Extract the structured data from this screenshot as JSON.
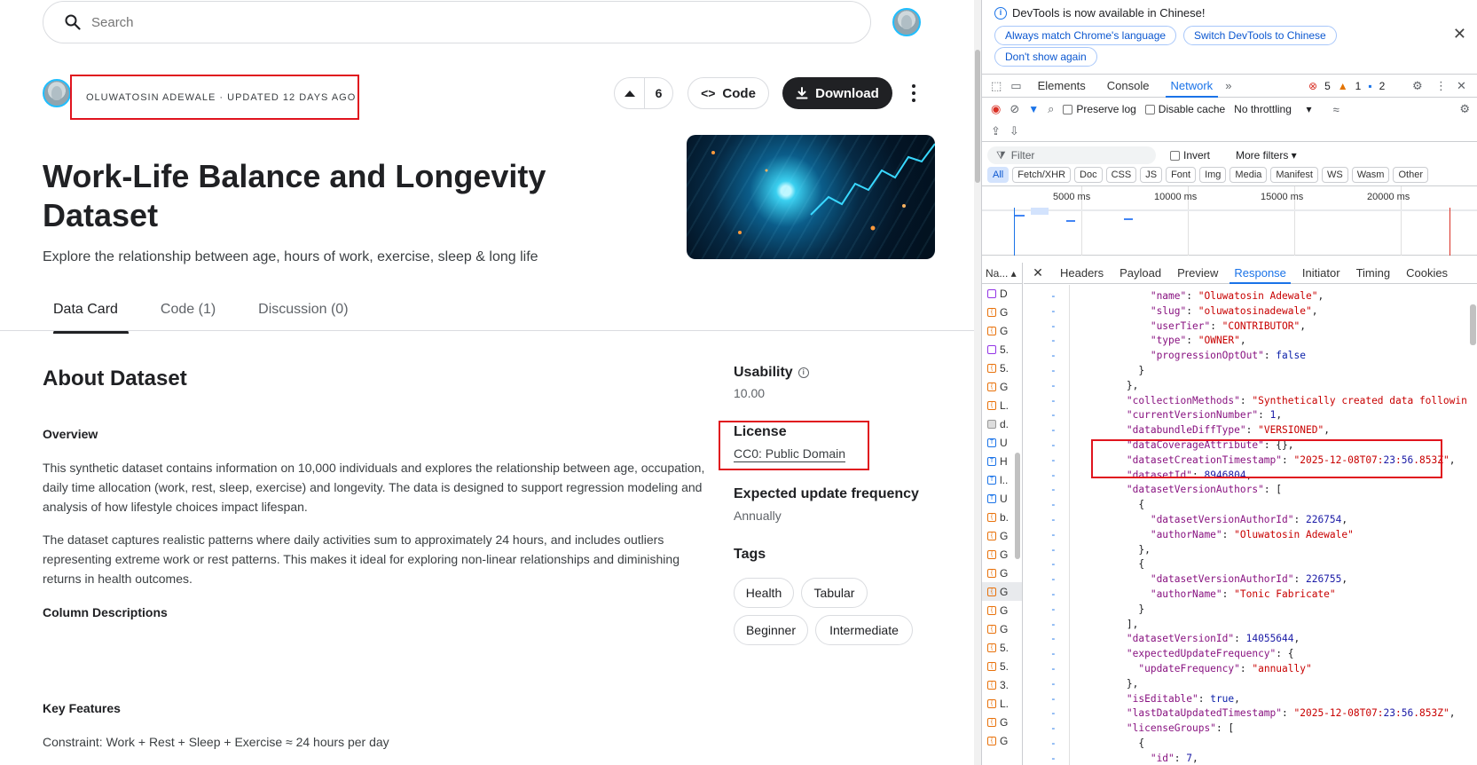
{
  "page": {
    "search_placeholder": "Search",
    "owner_line": "OLUWATOSIN ADEWALE · UPDATED 12 DAYS AGO",
    "vote_count": "6",
    "code_label": "Code",
    "download_label": "Download",
    "title": "Work-Life Balance and Longevity Dataset",
    "subtitle": "Explore the relationship between age, hours of work, exercise, sleep & long life",
    "tabs": [
      "Data Card",
      "Code (1)",
      "Discussion (0)"
    ],
    "about_heading": "About Dataset",
    "overview_heading": "Overview",
    "para1": "This synthetic dataset contains information on 10,000 individuals and explores the relationship between age, occupation, daily time allocation (work, rest, sleep, exercise) and longevity. The data is designed to support regression modeling and analysis of how lifestyle choices impact lifespan.",
    "para2": "The dataset captures realistic patterns where daily activities sum to approximately 24 hours, and includes outliers representing extreme work or rest patterns. This makes it ideal for exploring non-linear relationships and diminishing returns in health outcomes.",
    "column_heading": "Column Descriptions",
    "key_heading": "Key Features",
    "key_line": "Constraint: Work + Rest + Sleep + Exercise ≈ 24 hours per day",
    "usability_label": "Usability",
    "usability_value": "10.00",
    "license_label": "License",
    "license_value": "CC0: Public Domain",
    "freq_label": "Expected update frequency",
    "freq_value": "Annually",
    "tags_label": "Tags",
    "tags": [
      "Health",
      "Tabular",
      "Beginner",
      "Intermediate"
    ]
  },
  "devtools": {
    "info_message": "DevTools is now available in Chinese!",
    "btn_match": "Always match Chrome's language",
    "btn_switch": "Switch DevTools to Chinese",
    "btn_dont": "Don't show again",
    "tabs": [
      "Elements",
      "Console",
      "Network"
    ],
    "errors": "5",
    "warnings": "1",
    "messages": "2",
    "preserve_log": "Preserve log",
    "disable_cache": "Disable cache",
    "throttling": "No throttling",
    "filter_placeholder": "Filter",
    "invert": "Invert",
    "more_filters": "More filters",
    "types": [
      "All",
      "Fetch/XHR",
      "Doc",
      "CSS",
      "JS",
      "Font",
      "Img",
      "Media",
      "Manifest",
      "WS",
      "Wasm",
      "Other"
    ],
    "timeline_labels": [
      "5000 ms",
      "10000 ms",
      "15000 ms",
      "20000 ms"
    ],
    "names_header": "Na...",
    "name_rows": [
      "D",
      "G",
      "G",
      "5.",
      "5.",
      "G",
      "L.",
      "d.",
      "U",
      "H",
      "l..",
      "U",
      "b.",
      "G",
      "G",
      "G",
      "G",
      "G",
      "G",
      "5.",
      "5.",
      "3.",
      "L.",
      "G",
      "G"
    ],
    "detail_tabs": [
      "Headers",
      "Payload",
      "Preview",
      "Response",
      "Initiator",
      "Timing",
      "Cookies"
    ],
    "code_lines": [
      "            \"name\": \"Oluwatosin Adewale\",",
      "            \"slug\": \"oluwatosinadewale\",",
      "            \"userTier\": \"CONTRIBUTOR\",",
      "            \"type\": \"OWNER\",",
      "            \"progressionOptOut\": false",
      "          }",
      "        },",
      "        \"collectionMethods\": \"Synthetically created data followin",
      "        \"currentVersionNumber\": 1,",
      "        \"databundleDiffType\": \"VERSIONED\",",
      "        \"dataCoverageAttribute\": {},",
      "        \"datasetCreationTimestamp\": \"2025-12-08T07:23:56.853Z\",",
      "        \"datasetId\": 8946804,",
      "        \"datasetVersionAuthors\": [",
      "          {",
      "            \"datasetVersionAuthorId\": 226754,",
      "            \"authorName\": \"Oluwatosin Adewale\"",
      "          },",
      "          {",
      "            \"datasetVersionAuthorId\": 226755,",
      "            \"authorName\": \"Tonic Fabricate\"",
      "          }",
      "        ],",
      "        \"datasetVersionId\": 14055644,",
      "        \"expectedUpdateFrequency\": {",
      "          \"updateFrequency\": \"annually\"",
      "        },",
      "        \"isEditable\": true,",
      "        \"lastDataUpdatedTimestamp\": \"2025-12-08T07:23:56.853Z\",",
      "        \"licenseGroups\": [",
      "          {",
      "            \"id\": 7,"
    ]
  }
}
